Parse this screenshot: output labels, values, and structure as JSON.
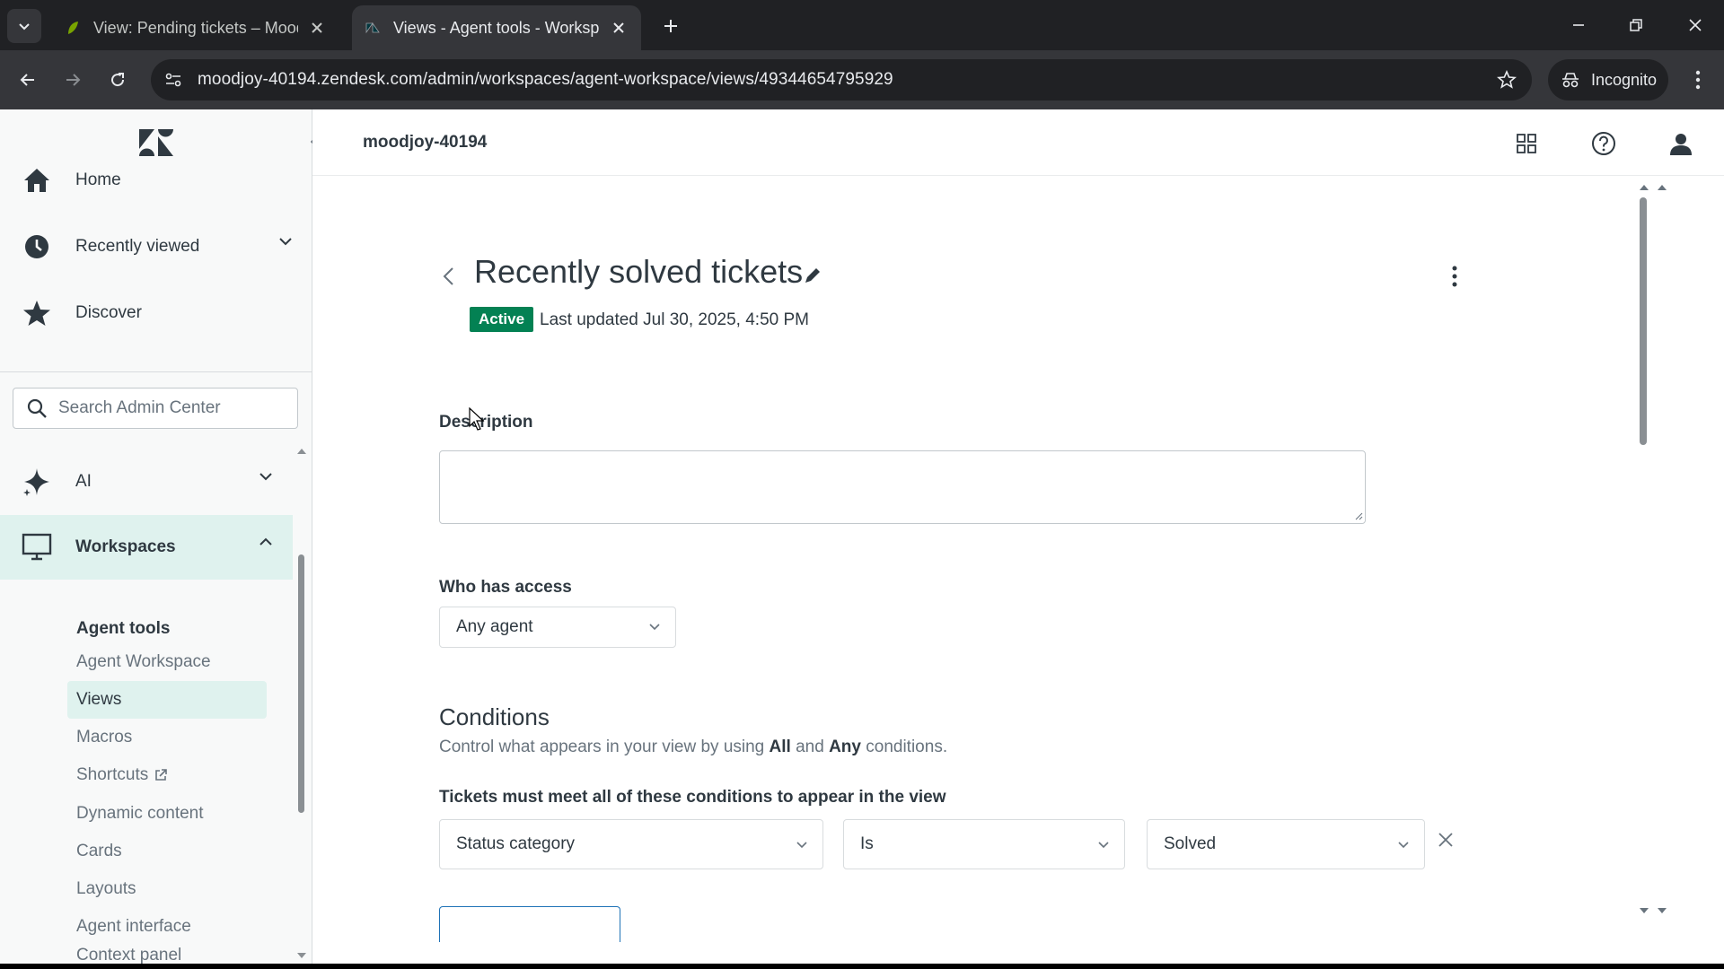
{
  "browser": {
    "tabs": [
      {
        "title": "View: Pending tickets – Moodjo"
      },
      {
        "title": "Views - Agent tools - Workspac"
      }
    ],
    "url": "moodjoy-40194.zendesk.com/admin/workspaces/agent-workspace/views/49344654795929",
    "incognito_label": "Incognito"
  },
  "header": {
    "account_name": "moodjoy-40194"
  },
  "sidebar": {
    "nav": [
      {
        "label": "Home",
        "icon": "home-icon"
      },
      {
        "label": "Recently viewed",
        "icon": "clock-icon"
      },
      {
        "label": "Discover",
        "icon": "star-icon"
      }
    ],
    "search_placeholder": "Search Admin Center",
    "sections": [
      {
        "label": "AI",
        "icon": "sparkle-icon"
      },
      {
        "label": "Workspaces",
        "icon": "monitor-icon"
      }
    ],
    "subsection_title": "Agent tools",
    "subitems": [
      {
        "label": "Agent Workspace"
      },
      {
        "label": "Views"
      },
      {
        "label": "Macros"
      },
      {
        "label": "Shortcuts"
      },
      {
        "label": "Dynamic content"
      },
      {
        "label": "Cards"
      },
      {
        "label": "Layouts"
      },
      {
        "label": "Agent interface"
      },
      {
        "label": "Context panel"
      }
    ],
    "active_subitem": "Views"
  },
  "view": {
    "title": "Recently solved tickets",
    "status_badge": "Active",
    "last_updated": "Last updated Jul 30, 2025, 4:50 PM",
    "description_label": "Description",
    "description_value": "",
    "access_label": "Who has access",
    "access_value": "Any agent",
    "conditions_title": "Conditions",
    "conditions_help": {
      "pre": "Control what appears in your view by using ",
      "all": "All",
      "mid": " and ",
      "any": "Any",
      "post": " conditions."
    },
    "all_conditions_heading": "Tickets must meet all of these conditions to appear in the view",
    "condition": {
      "field": "Status category",
      "operator": "Is",
      "value": "Solved"
    }
  },
  "colors": {
    "active_badge": "#038153",
    "sidebar_active": "#dff2ee",
    "browser_bg": "#202124"
  }
}
